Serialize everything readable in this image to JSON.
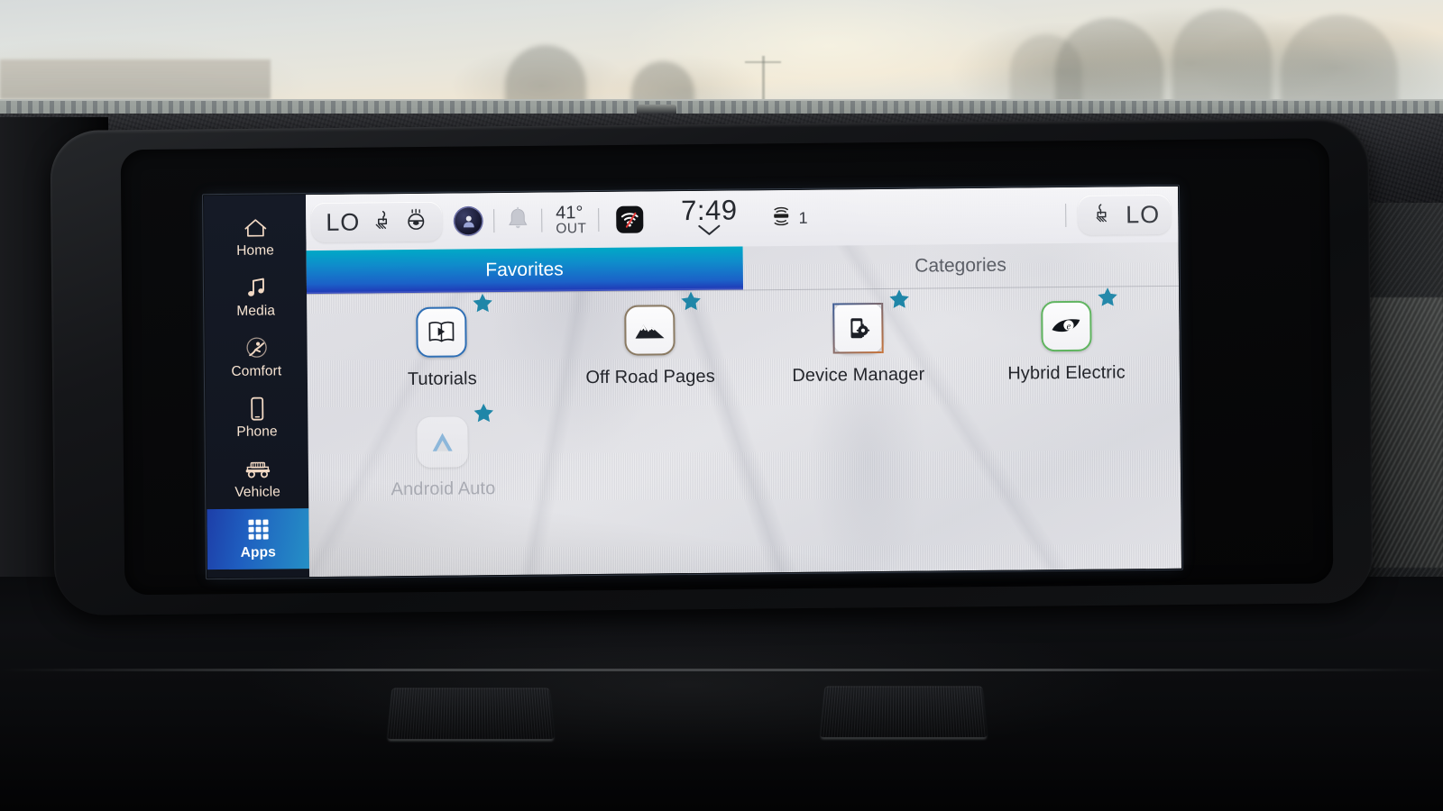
{
  "device": {
    "name": "vehicle-infotainment-touchscreen"
  },
  "status_bar": {
    "climate_left": {
      "temp": "LO",
      "icons": [
        "heated-seat-icon",
        "heated-steering-wheel-icon"
      ]
    },
    "profile": {
      "icon": "user-profile-icon"
    },
    "notifications": {
      "icon": "bell-icon"
    },
    "outside_temp": {
      "value": "41°",
      "label": "OUT"
    },
    "wifi": {
      "icon": "wifi-off-icon",
      "state": "off"
    },
    "clock": {
      "time": "7:49",
      "expand_icon": "chevron-down-icon"
    },
    "radio": {
      "icon": "siriusxm-icon",
      "preset": "1"
    },
    "climate_right": {
      "temp": "LO",
      "icons": [
        "heated-seat-icon"
      ]
    }
  },
  "sidebar": {
    "items": [
      {
        "label": "Home",
        "icon": "home-icon",
        "active": false
      },
      {
        "label": "Media",
        "icon": "music-note-icon",
        "active": false
      },
      {
        "label": "Comfort",
        "icon": "comfort-seat-icon",
        "active": false
      },
      {
        "label": "Phone",
        "icon": "phone-icon",
        "active": false
      },
      {
        "label": "Vehicle",
        "icon": "vehicle-icon",
        "active": false
      },
      {
        "label": "Apps",
        "icon": "apps-grid-icon",
        "active": true
      }
    ]
  },
  "tabs": [
    {
      "label": "Favorites",
      "active": true
    },
    {
      "label": "Categories",
      "active": false
    }
  ],
  "apps": [
    {
      "label": "Tutorials",
      "icon": "tutorials-icon",
      "favorite": true,
      "enabled": true,
      "border": "b-blue"
    },
    {
      "label": "Off Road Pages",
      "icon": "mountain-icon",
      "favorite": true,
      "enabled": true,
      "border": "b-tan"
    },
    {
      "label": "Device Manager",
      "icon": "device-manager-icon",
      "favorite": true,
      "enabled": true,
      "border": "b-orng"
    },
    {
      "label": "Hybrid Electric",
      "icon": "hybrid-electric-icon",
      "favorite": true,
      "enabled": true,
      "border": "b-grn"
    },
    {
      "label": "Android Auto",
      "icon": "android-auto-icon",
      "favorite": true,
      "enabled": false,
      "border": "plain"
    }
  ],
  "colors": {
    "accent_blue": "#1b61c8",
    "accent_cyan": "#00a9c6",
    "star_teal": "#1f86a8",
    "sidebar_bg": "#151a26",
    "sidebar_icon": "#f2d9c4",
    "panel_bg": "#e2e2e7"
  }
}
